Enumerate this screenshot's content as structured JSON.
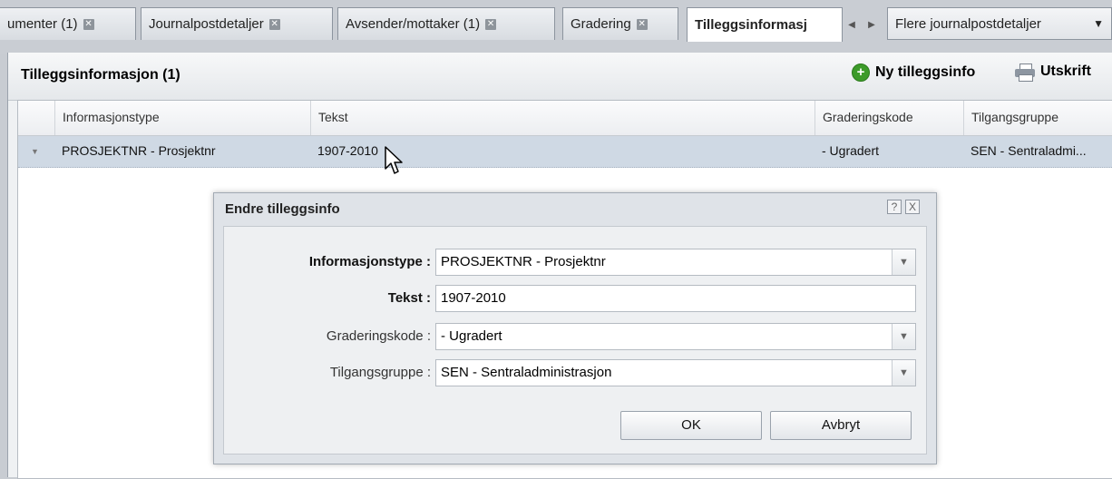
{
  "tabs": [
    {
      "label": "umenter (1)",
      "closable": true
    },
    {
      "label": "Journalpostdetaljer",
      "closable": true
    },
    {
      "label": "Avsender/mottaker (1)",
      "closable": true
    },
    {
      "label": "Gradering",
      "closable": true
    },
    {
      "label": "Tilleggsinformasj",
      "closable": false,
      "active": true
    }
  ],
  "tab_dropdown": {
    "label": "Flere journalpostdetaljer"
  },
  "panel": {
    "title": "Tilleggsinformasjon (1)",
    "new_button": "Ny tilleggsinfo",
    "print_button": "Utskrift"
  },
  "grid": {
    "columns": [
      "Informasjonstype",
      "Tekst",
      "Graderingskode",
      "Tilgangsgruppe"
    ],
    "rows": [
      [
        "PROSJEKTNR - Prosjektnr",
        "1907-2010",
        "- Ugradert",
        "SEN - Sentraladmi..."
      ]
    ]
  },
  "dialog": {
    "title": "Endre tilleggsinfo",
    "help": "?",
    "close": "X",
    "fields": [
      {
        "label": "Informasjonstype :",
        "value": "PROSJEKTNR - Prosjektnr",
        "required": true,
        "dropdown": true
      },
      {
        "label": "Tekst :",
        "value": "1907-2010",
        "required": true,
        "dropdown": false
      },
      {
        "label": "Graderingskode :",
        "value": "- Ugradert",
        "required": false,
        "dropdown": true
      },
      {
        "label": "Tilgangsgruppe :",
        "value": "SEN - Sentraladministrasjon",
        "required": false,
        "dropdown": true
      }
    ],
    "ok": "OK",
    "cancel": "Avbryt"
  }
}
